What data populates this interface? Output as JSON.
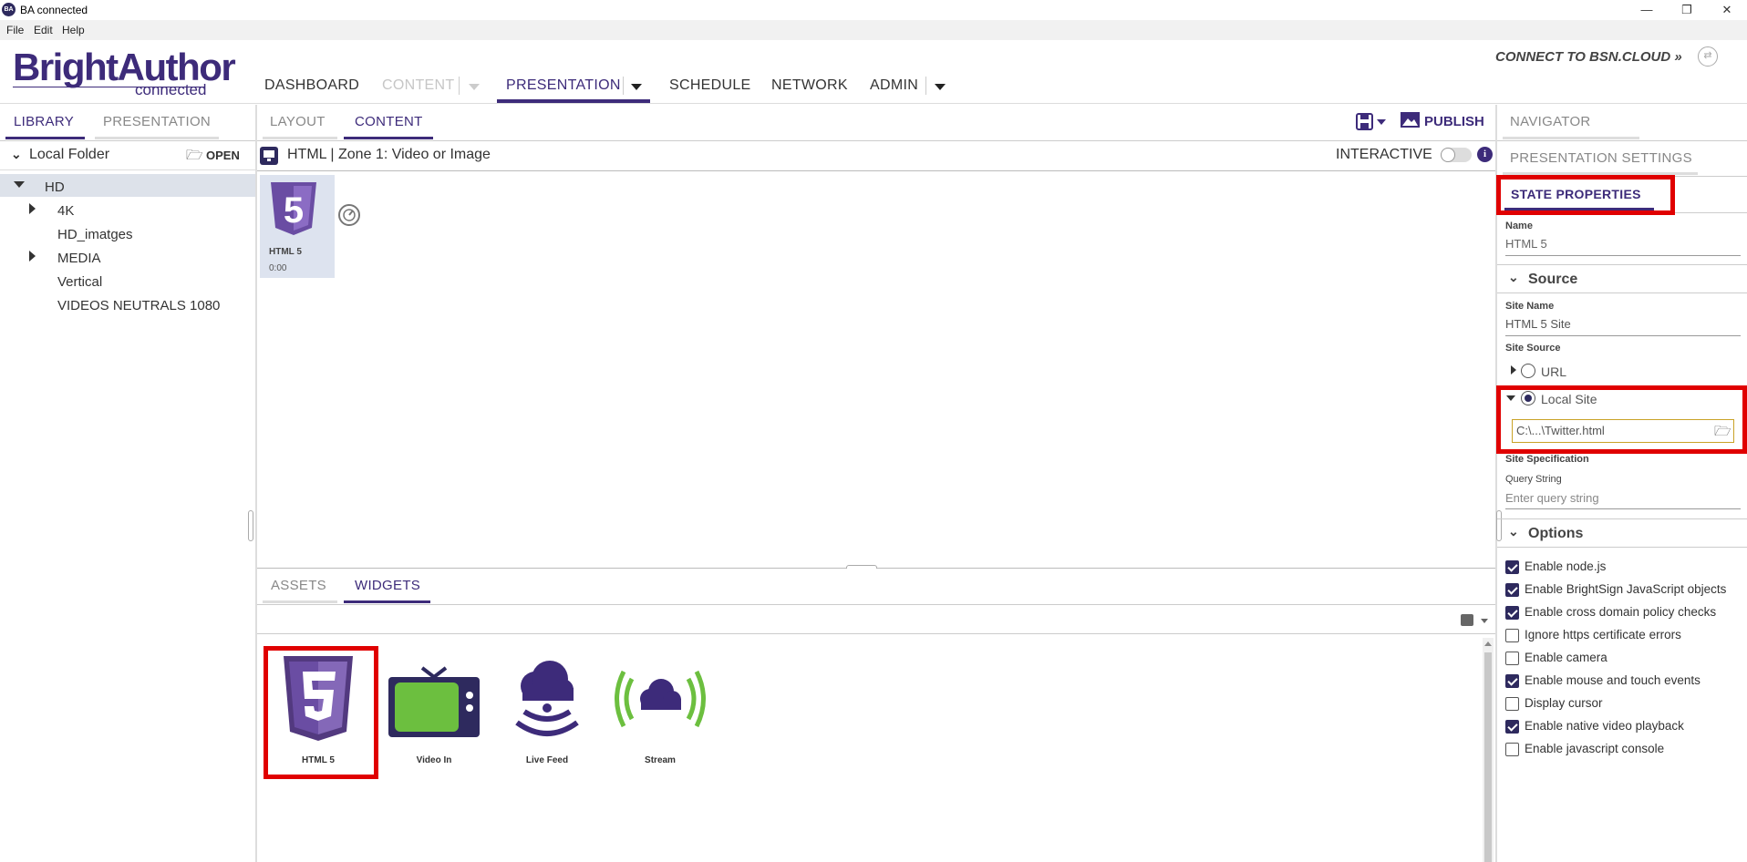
{
  "window": {
    "app_icon": "BA",
    "title": "BA connected",
    "minimize": "—",
    "restore": "❐",
    "close": "✕"
  },
  "menu": [
    "File",
    "Edit",
    "Help"
  ],
  "logo": {
    "main": "BrightAuthor",
    "sub": "connected"
  },
  "nav": {
    "dashboard": "DASHBOARD",
    "content": "CONTENT",
    "presentation": "PRESENTATION",
    "schedule": "SCHEDULE",
    "network": "NETWORK",
    "admin": "ADMIN",
    "connect": "CONNECT TO BSN.CLOUD »",
    "sync_icon": "⇄"
  },
  "left": {
    "tabs": [
      "LIBRARY",
      "PRESENTATION"
    ],
    "folder_title": "Local Folder",
    "open_label": "OPEN",
    "folder_icon": "🗁",
    "tree": [
      "HD",
      "4K",
      "HD_imatges",
      "MEDIA",
      "Vertical",
      "VIDEOS NEUTRALS 1080"
    ]
  },
  "center": {
    "tabs": [
      "LAYOUT",
      "CONTENT"
    ],
    "publish_label": "PUBLISH",
    "zone_title": "HTML | Zone 1: Video or Image",
    "interactive_label": "INTERACTIVE",
    "info_icon": "i",
    "state": {
      "icon_text": "5",
      "name": "HTML 5",
      "duration": "0:00"
    },
    "bottom_tabs": [
      "ASSETS",
      "WIDGETS"
    ],
    "widgets": [
      {
        "label": "HTML 5",
        "icon": "html5-icon"
      },
      {
        "label": "Video In",
        "icon": "tv-icon"
      },
      {
        "label": "Live Feed",
        "icon": "live-feed-icon"
      },
      {
        "label": "Stream",
        "icon": "stream-icon"
      }
    ]
  },
  "right": {
    "tabs": [
      "NAVIGATOR",
      "PRESENTATION SETTINGS",
      "STATE PROPERTIES"
    ],
    "name_label": "Name",
    "name_value": "HTML 5",
    "source_section": "Source",
    "site_name_label": "Site Name",
    "site_name_value": "HTML 5 Site",
    "site_source_label": "Site Source",
    "url_label": "URL",
    "local_site_label": "Local Site",
    "local_site_path": "C:\\...\\Twitter.html",
    "site_spec_label": "Site Specification",
    "query_label": "Query String",
    "query_placeholder": "Enter query string",
    "options_section": "Options",
    "options": [
      {
        "label": "Enable node.js",
        "checked": true
      },
      {
        "label": "Enable BrightSign JavaScript objects",
        "checked": true
      },
      {
        "label": "Enable cross domain policy checks",
        "checked": true
      },
      {
        "label": "Ignore https certificate errors",
        "checked": false
      },
      {
        "label": "Enable camera",
        "checked": false
      },
      {
        "label": "Enable mouse and touch events",
        "checked": true
      },
      {
        "label": "Display cursor",
        "checked": false
      },
      {
        "label": "Enable native video playback",
        "checked": true
      },
      {
        "label": "Enable javascript console",
        "checked": false
      }
    ]
  },
  "colors": {
    "accent": "#3d2b7a",
    "highlight": "#e00000",
    "widget_green": "#6cbf3f"
  }
}
